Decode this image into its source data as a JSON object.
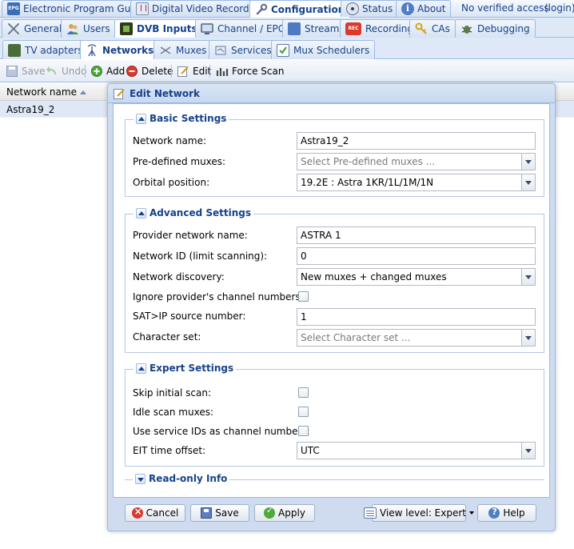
{
  "top_tabs": {
    "epg": "Electronic Program Guide",
    "dvr": "Digital Video Recorder",
    "configuration": "Configuration",
    "status": "Status",
    "about": "About",
    "access": "No verified access",
    "login": "(login)"
  },
  "config_tabs": {
    "general": "General",
    "users": "Users",
    "dvb_inputs": "DVB Inputs",
    "channel_epg": "Channel / EPG",
    "stream": "Stream",
    "recording": "Recording",
    "cas": "CAs",
    "debugging": "Debugging"
  },
  "dvb_tabs": {
    "tv_adapters": "TV adapters",
    "networks": "Networks",
    "muxes": "Muxes",
    "services": "Services",
    "mux_schedulers": "Mux Schedulers"
  },
  "toolbar": {
    "save": "Save",
    "undo": "Undo",
    "add": "Add",
    "delete": "Delete",
    "edit": "Edit",
    "force_scan": "Force Scan"
  },
  "grid": {
    "column_network_name": "Network name",
    "row_network_name": "Astra19_2"
  },
  "dialog": {
    "title": "Edit Network",
    "basic": {
      "legend": "Basic Settings",
      "network_name_label": "Network name:",
      "network_name_value": "Astra19_2",
      "predefined_label": "Pre-defined muxes:",
      "predefined_placeholder": "Select Pre-defined muxes ...",
      "orbital_label": "Orbital position:",
      "orbital_value": "19.2E : Astra 1KR/1L/1M/1N"
    },
    "advanced": {
      "legend": "Advanced Settings",
      "provider_label": "Provider network name:",
      "provider_value": "ASTRA 1",
      "netid_label": "Network ID (limit scanning):",
      "netid_value": "0",
      "discovery_label": "Network discovery:",
      "discovery_value": "New muxes + changed muxes",
      "ignore_label": "Ignore provider's channel numbers:",
      "satip_label": "SAT>IP source number:",
      "satip_value": "1",
      "charset_label": "Character set:",
      "charset_placeholder": "Select Character set ..."
    },
    "expert": {
      "legend": "Expert Settings",
      "skip_label": "Skip initial scan:",
      "idle_label": "Idle scan muxes:",
      "sid_label": "Use service IDs as channel numbers:",
      "eit_label": "EIT time offset:",
      "eit_value": "UTC"
    },
    "readonly": {
      "legend": "Read-only Info"
    },
    "buttons": {
      "cancel": "Cancel",
      "save": "Save",
      "apply": "Apply",
      "view_level": "View level: Expert",
      "help": "Help"
    }
  },
  "colors": {
    "accent": "#15428b",
    "border": "#99bbe8",
    "header_bg": "#dfe8f6"
  }
}
